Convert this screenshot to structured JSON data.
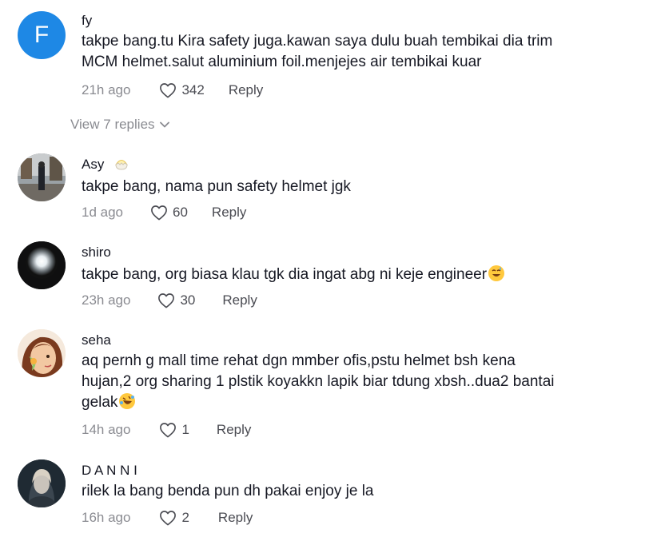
{
  "comments": [
    {
      "avatar_letter": "F",
      "username": "fy",
      "text": "takpe bang.tu Kira safety juga.kawan saya dulu buah tembikai dia trim MCM helmet.salut aluminium foil.menjejes air tembikai kuar",
      "time": "21h ago",
      "likes": "342",
      "reply_label": "Reply"
    },
    {
      "username": "Asy",
      "text": "takpe bang, nama pun safety helmet jgk",
      "time": "1d ago",
      "likes": "60",
      "reply_label": "Reply"
    },
    {
      "username": "shiro",
      "text": "takpe bang, org biasa klau tgk dia ingat abg ni keje engineer",
      "time": "23h ago",
      "likes": "30",
      "reply_label": "Reply"
    },
    {
      "username": "seha",
      "text": "aq pernh g mall time rehat dgn mmber ofis,pstu helmet bsh kena hujan,2 org sharing 1 plstik koyakkn lapik biar tdung xbsh..dua2 bantai gelak",
      "time": "14h ago",
      "likes": "1",
      "reply_label": "Reply"
    },
    {
      "username": "D A N N I",
      "text": "rilek la bang benda pun dh pakai enjoy je la",
      "time": "16h ago",
      "likes": "2",
      "reply_label": "Reply"
    }
  ],
  "view_replies_label": "View 7 replies",
  "icons": {
    "like": "heart-outline-icon",
    "expand": "chevron-down-icon"
  },
  "colors": {
    "avatar_fy": "#1e88e5",
    "muted_text": "#8a8b91",
    "primary_text": "#161823"
  }
}
